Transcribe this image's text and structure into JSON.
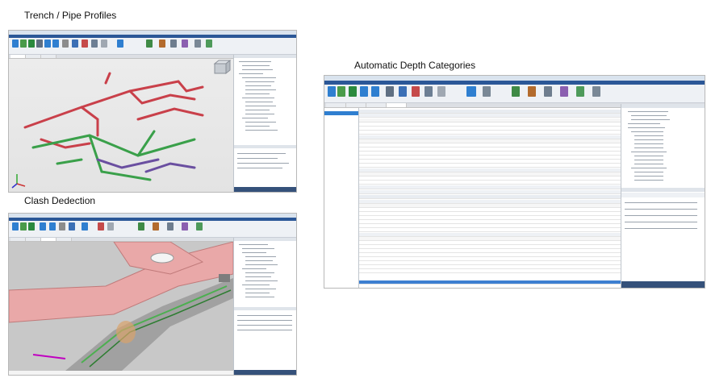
{
  "captions": {
    "trench": "Trench / Pipe Profiles",
    "clash": "Clash Dedection",
    "depth": "Automatic Depth Categories"
  },
  "colors": {
    "ribbon_blue": "#2f7fd0",
    "pipe_red": "#c9404a",
    "pipe_green": "#3aa04a",
    "pipe_purple": "#6a4fa0",
    "clash_pink": "#e9a8a8",
    "status_bar": "#35517a"
  },
  "icons": [
    "view-cube-icon",
    "axis-icon"
  ]
}
